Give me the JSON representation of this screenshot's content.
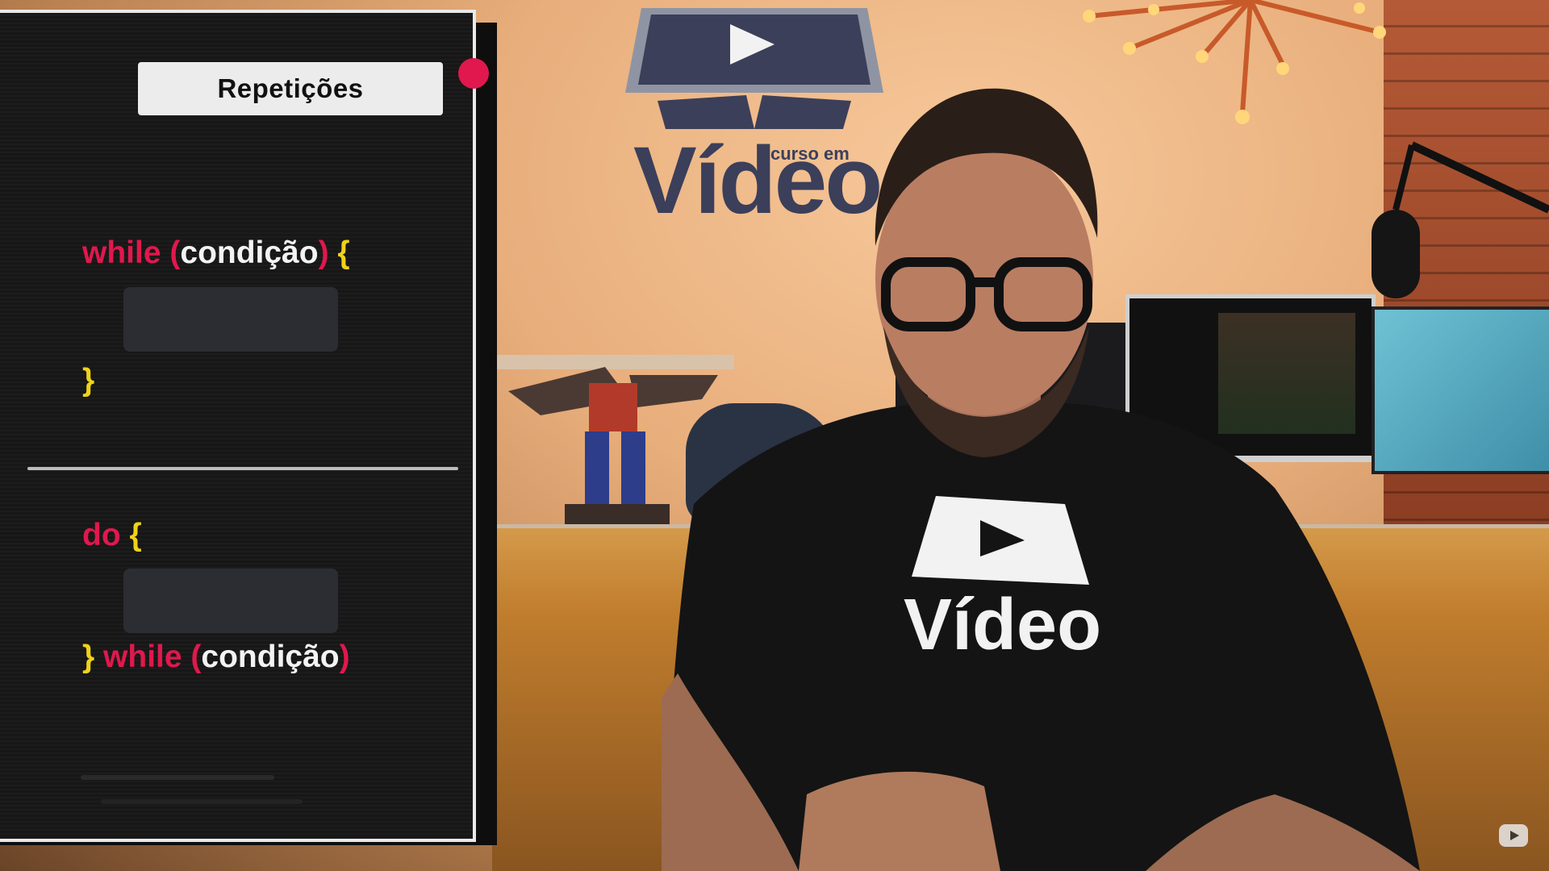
{
  "panel": {
    "title": "Repetições",
    "while_loop": {
      "keyword": "while",
      "open_paren": "(",
      "condition": "condição",
      "close_paren": ")",
      "open_brace": "{",
      "close_brace": "}"
    },
    "do_while_loop": {
      "keyword_do": "do",
      "open_brace": "{",
      "close_brace": "}",
      "keyword_while": "while",
      "open_paren": "(",
      "condition": "condição",
      "close_paren": ")"
    }
  },
  "background": {
    "logo_main": "Vídeo",
    "logo_small": "curso em"
  },
  "colors": {
    "keyword": "#e0184d",
    "brace": "#f0d21a",
    "condition": "#f3f3f3",
    "record_dot": "#e0184d",
    "logo": "#3b3f5a"
  },
  "icons": [
    "record-dot-icon",
    "youtube-play-icon"
  ]
}
